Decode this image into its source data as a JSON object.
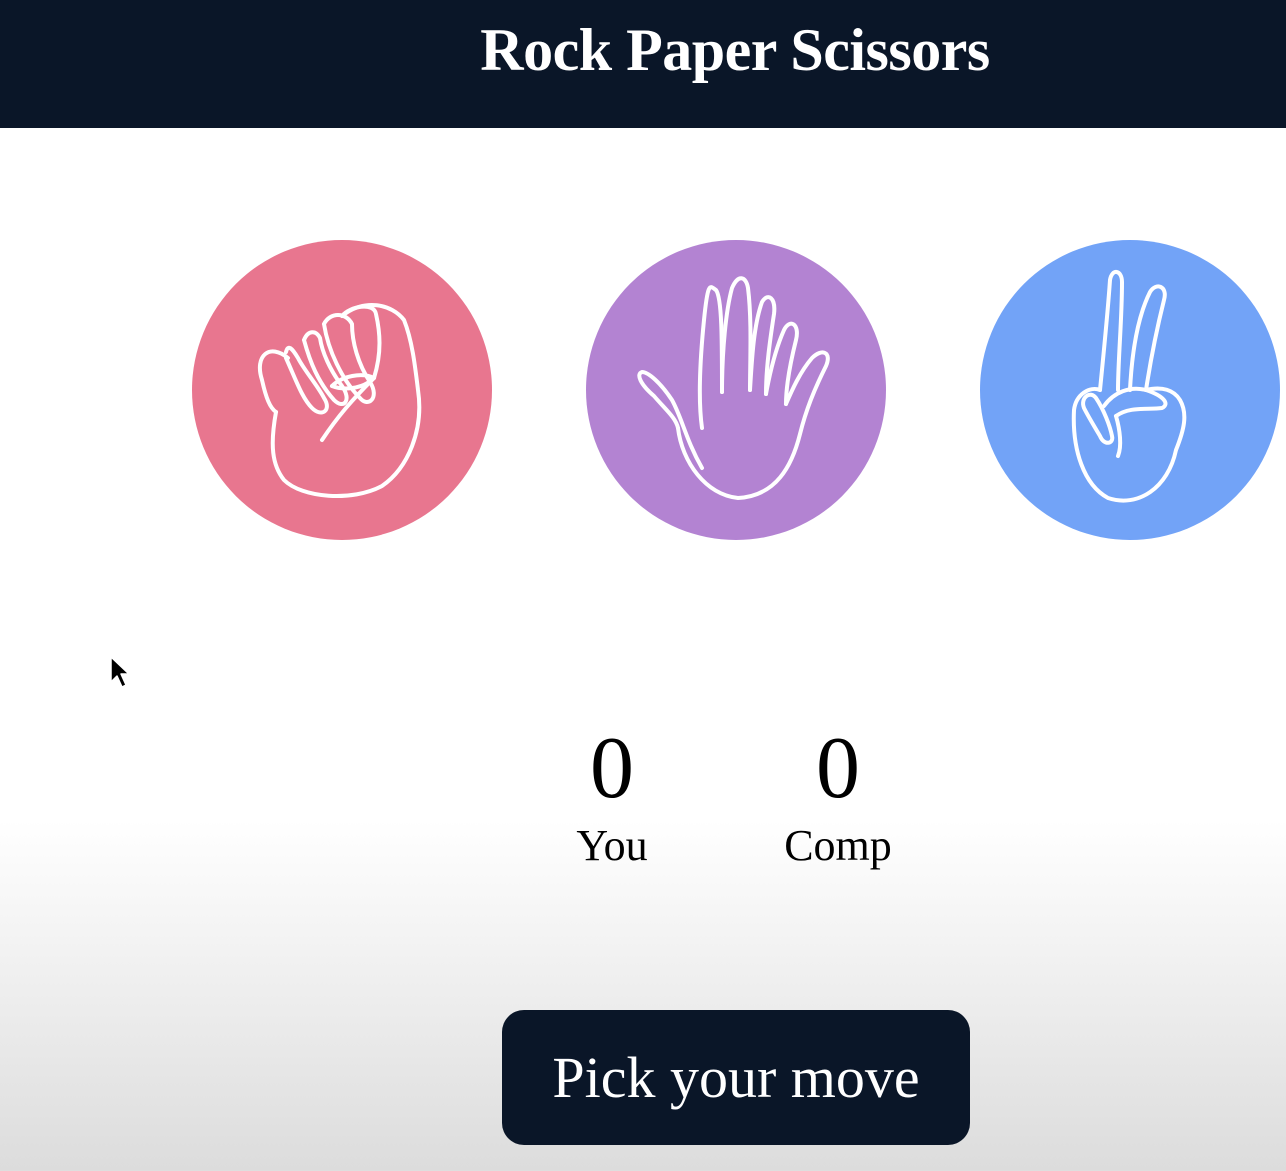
{
  "header": {
    "title": "Rock Paper Scissors"
  },
  "choices": [
    {
      "icon": "fist-icon",
      "color": "#e8768f"
    },
    {
      "icon": "open-hand-icon",
      "color": "#b383d2"
    },
    {
      "icon": "peace-hand-icon",
      "color": "#72a3f7"
    }
  ],
  "scores": {
    "player": {
      "value": "0",
      "label": "You"
    },
    "computer": {
      "value": "0",
      "label": "Comp"
    }
  },
  "action": {
    "label": "Pick your move"
  },
  "colors": {
    "header_bg": "#0a1628",
    "button_bg": "#0a1628",
    "text_light": "#ffffff"
  }
}
